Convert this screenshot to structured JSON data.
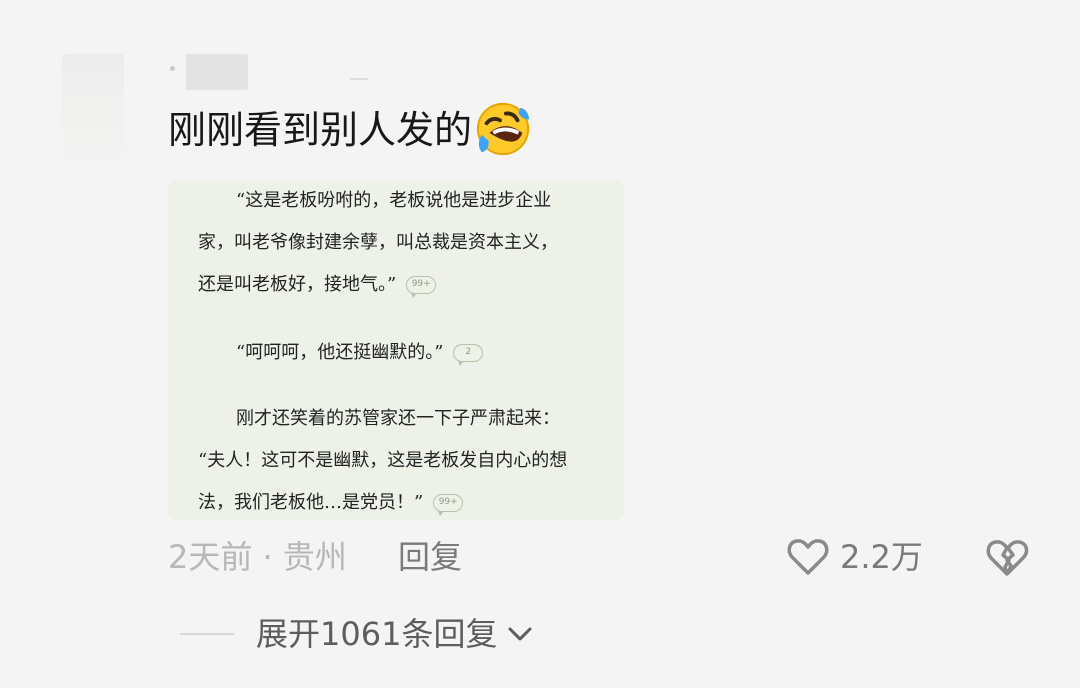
{
  "comment": {
    "text": "刚刚看到别人发的",
    "emoji": "rolling-on-floor-laughing-emoji",
    "screenshot": {
      "paragraph1": [
        "“这是老板吩咐的，老板说他是进步企业",
        "家，叫老爷像封建余孽，叫总裁是资本主义，",
        "还是叫老板好，接地气。”"
      ],
      "bubble1": "99+",
      "paragraph2": "“呵呵呵，他还挺幽默的。”",
      "bubble2": "2",
      "paragraph3": [
        "刚才还笑着的苏管家还一下子严肃起来：",
        "“夫人！这可不是幽默，这是老板发自内心的想",
        "法，我们老板他…是党员！”"
      ],
      "bubble3": "99+"
    }
  },
  "meta": {
    "time_location": "2天前 · 贵州",
    "reply_label": "回复",
    "like_count": "2.2万"
  },
  "expand": {
    "label": "展开1061条回复"
  },
  "colors": {
    "background": "#f4f4f4",
    "card": "#edf1e8",
    "meta_text": "#b7b7b7",
    "action_text": "#7a7a7a"
  }
}
